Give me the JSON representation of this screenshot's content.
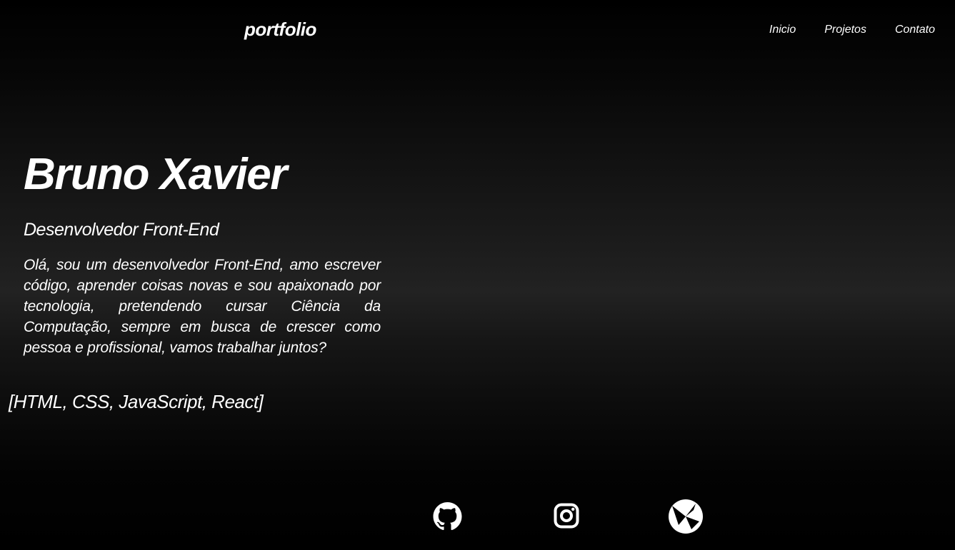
{
  "header": {
    "logo": "portfolio",
    "nav": [
      {
        "label": "Inicio"
      },
      {
        "label": "Projetos"
      },
      {
        "label": "Contato"
      }
    ]
  },
  "hero": {
    "name": "Bruno Xavier",
    "role": "Desenvolvedor Front-End",
    "description": "Olá, sou um desenvolvedor Front-End, amo escrever código, aprender coisas novas e sou apaixonado por tecnologia, pretendendo cursar Ciência da Computação, sempre em busca de crescer como pessoa e profissional, vamos trabalhar juntos?",
    "skills": "[HTML, CSS, JavaScript, React]"
  },
  "socials": [
    {
      "icon": "github-icon"
    },
    {
      "icon": "instagram-icon"
    },
    {
      "icon": "portal-icon"
    }
  ],
  "colors": {
    "background": "#000000",
    "text": "#ffffff"
  }
}
